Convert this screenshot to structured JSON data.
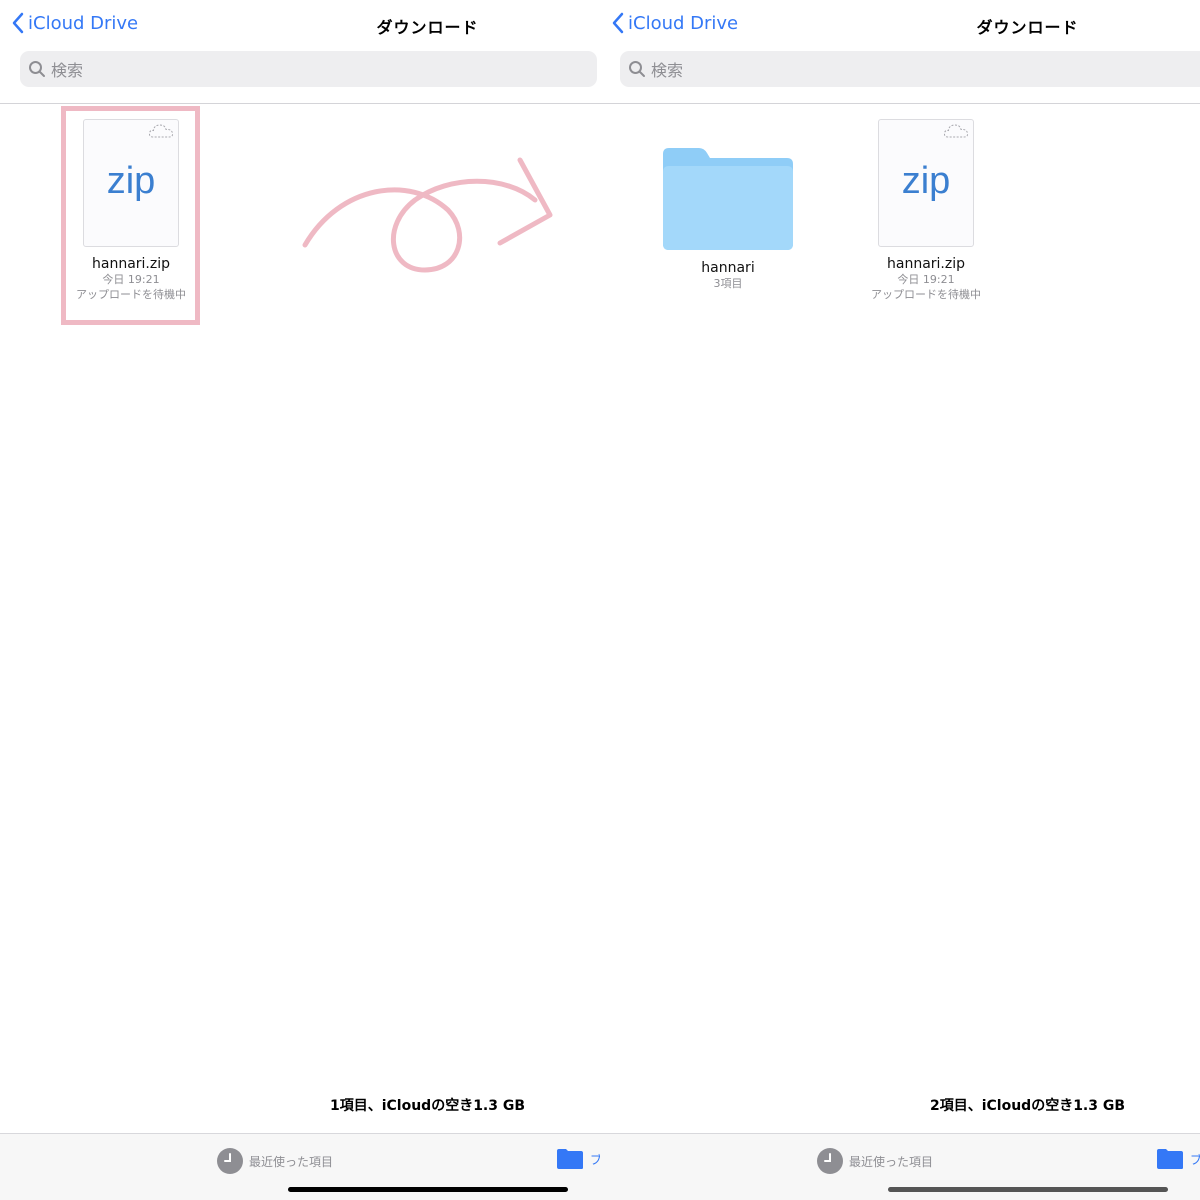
{
  "left": {
    "nav": {
      "back_label": "iCloud Drive",
      "title": "ダウンロード"
    },
    "search": {
      "placeholder": "検索"
    },
    "files": [
      {
        "name": "hannari.zip",
        "ext": "zip",
        "date": "今日 19:21",
        "status": "アップロードを待機中"
      }
    ],
    "summary": "1項目、iCloudの空き1.3 GB",
    "tabs": {
      "recents_label": "最近使った項目",
      "browse_label": "ブ"
    }
  },
  "right": {
    "nav": {
      "back_label": "iCloud Drive",
      "title": "ダウンロード"
    },
    "search": {
      "placeholder": "検索"
    },
    "folders": [
      {
        "name": "hannari",
        "count": "3項目"
      }
    ],
    "files": [
      {
        "name": "hannari.zip",
        "ext": "zip",
        "date": "今日 19:21",
        "status": "アップロードを待機中"
      }
    ],
    "summary": "2項目、iCloudの空き1.3 GB",
    "tabs": {
      "recents_label": "最近使った項目",
      "browse_label": "ブ"
    }
  },
  "colors": {
    "accent": "#3478f6",
    "highlight": "#efb9c4",
    "folder": "#8fcdf7"
  }
}
